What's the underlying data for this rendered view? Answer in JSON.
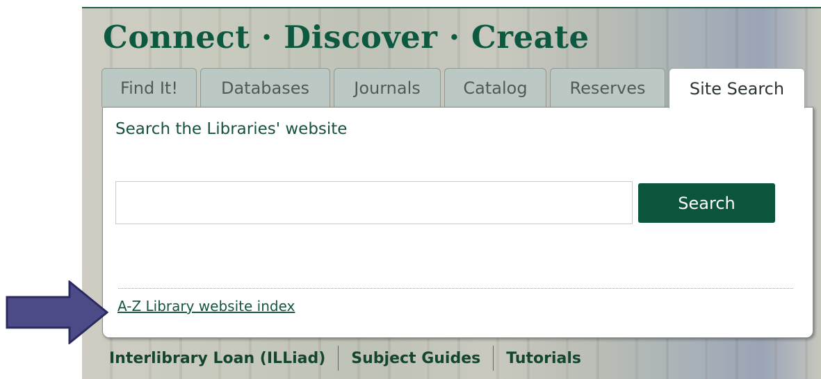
{
  "header": {
    "title": "Connect · Discover · Create"
  },
  "tabs": [
    {
      "label": "Find It!",
      "active": false
    },
    {
      "label": "Databases",
      "active": false
    },
    {
      "label": "Journals",
      "active": false
    },
    {
      "label": "Catalog",
      "active": false
    },
    {
      "label": "Reserves",
      "active": false
    },
    {
      "label": "Site Search",
      "active": true
    }
  ],
  "panel": {
    "heading": "Search the Libraries' website",
    "search_value": "",
    "search_placeholder": "",
    "search_button": "Search",
    "az_link": "A-Z Library website index"
  },
  "footer_links": [
    {
      "label": "Interlibrary Loan (ILLiad)"
    },
    {
      "label": "Subject Guides"
    },
    {
      "label": "Tutorials"
    }
  ],
  "annotation": {
    "icon": "right-arrow-icon",
    "fill": "#4d4b87",
    "stroke": "#2a2960"
  },
  "colors": {
    "brand_green": "#0b553d",
    "tab_inactive": "#bcc8c3"
  }
}
